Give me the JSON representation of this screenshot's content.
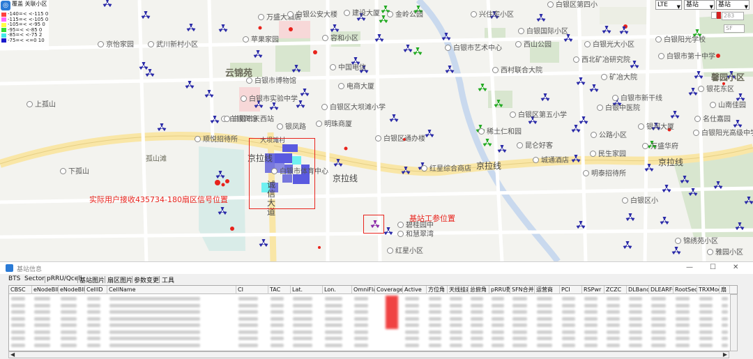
{
  "legend": {
    "header": "覆盖  关联小区",
    "rows": [
      {
        "label": "-140=<  <-115 0",
        "color": "#ff4040"
      },
      {
        "label": "-115=<  <-105 0",
        "color": "#ff66ff"
      },
      {
        "label": "-105=<  <-95 0",
        "color": "#ffff44"
      },
      {
        "label": "-95=<  <-85 0",
        "color": "#33dd33"
      },
      {
        "label": "-85=<  <-75 2",
        "color": "#44e8e8"
      },
      {
        "label": "-75=<  <=0 10",
        "color": "#1a1acc"
      }
    ]
  },
  "controls": {
    "network": "LTE",
    "layer1": "基站",
    "layer2": "基站",
    "search_value": "283",
    "sf_placeholder": "SF"
  },
  "map": {
    "areas": [
      "云锦苑",
      "孤山滩",
      "馨园小区"
    ],
    "roads": {
      "jinglaxian_1": "京拉线",
      "jinglaxian_2": "京拉线",
      "jinglaxian_3": "京拉线",
      "jinglaxian_4": "京拉线",
      "chengxin_dadao": "诚信大道",
      "dapo": "大坝滩村"
    },
    "pois": [
      "万盛大酒店",
      "白银公安大楼",
      "建设大厦",
      "金岭公园",
      "兴住宅小区",
      "白银区第四小",
      "苹果家园",
      "容和小区",
      "白银国际小区",
      "京怡家园",
      "武川新村小区",
      "白银市艺术中心",
      "西山公园",
      "白银光大小区",
      "白银阳光学校",
      "中国电信",
      "白银市博物馆",
      "电商大厦",
      "西村联合大院",
      "西北矿冶研究院",
      "白银市第十中学",
      "白银市实验中学",
      "白银区大坝滩小学",
      "矿冶大院",
      "上孤山",
      "白银区第五小学",
      "白银市新干线",
      "白银中医院",
      "白银宾馆",
      "银凤路",
      "白银市天西站",
      "明珠商厦",
      "银花东区",
      "稀土仁和园",
      "银河大厦",
      "山南佳园",
      "顺悦招待所",
      "白银区通办楼",
      "公路小区",
      "名仕嘉园",
      "昆仑好客",
      "万盛华府",
      "民生家园",
      "白银阳光高级中学",
      "下孤山",
      "白银市体育中心",
      "红星综合商店",
      "城通酒店",
      "明泰招待所",
      "白银区小",
      "碧桂园中",
      "和慧翠湾",
      "红星小区",
      "锦绣苑小区",
      "雅园小区"
    ],
    "annotation_user": "实际用户接收435734-180扇区信号位置",
    "annotation_site": "基站工参位置"
  },
  "window": {
    "title": "基站信息",
    "tabs": [
      "BTS",
      "Sector",
      "pRRU/Qcell",
      "基站图片",
      "扇区图片",
      "参数变更",
      "工具"
    ],
    "columns": [
      "CBSC",
      "eNodeBID",
      "eNodeBID",
      "CellID",
      "CellName",
      "CI",
      "TAC",
      "Lat.",
      "Lon.",
      "OmniFla",
      "Coverage",
      "Active",
      "方位角",
      "天线挂高",
      "总俯角",
      "pRRU数",
      "SFN合并",
      "运营商",
      "PCI",
      "RSPwr",
      "ZCZC",
      "DLBand",
      "DLEARFCN",
      "RootSeq",
      "TRXMod",
      "扇"
    ]
  },
  "colors": {
    "accent": "#2b7bd6",
    "annotation_red": "#e8231c",
    "coverage_blue": "#5a5ae0",
    "coverage_cyan": "#6ff0f0",
    "road_yellow": "#f9e6a6"
  }
}
